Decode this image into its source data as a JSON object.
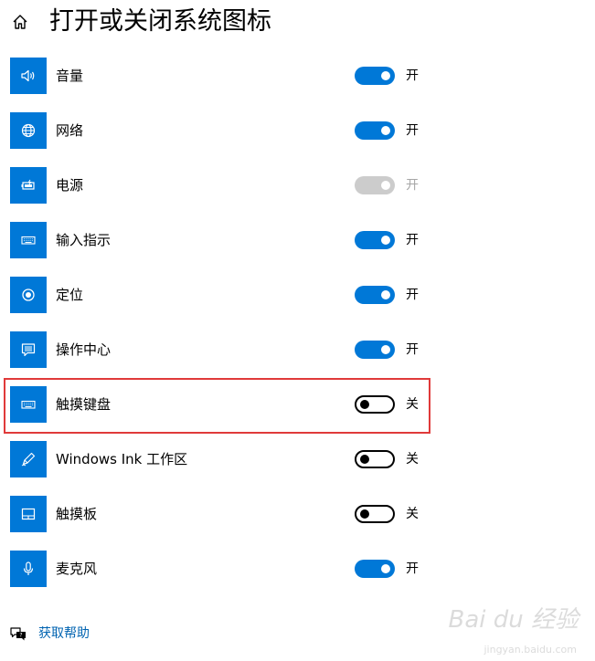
{
  "header": {
    "title": "打开或关闭系统图标",
    "home_icon": "home-icon"
  },
  "items": [
    {
      "name": "volume",
      "icon": "speaker-icon",
      "label": "音量",
      "state": "开",
      "toggle": "on"
    },
    {
      "name": "network",
      "icon": "globe-icon",
      "label": "网络",
      "state": "开",
      "toggle": "on"
    },
    {
      "name": "power",
      "icon": "battery-icon",
      "label": "电源",
      "state": "开",
      "toggle": "disabled"
    },
    {
      "name": "input-indicator",
      "icon": "keyboard-icon",
      "label": "输入指示",
      "state": "开",
      "toggle": "on"
    },
    {
      "name": "location",
      "icon": "location-icon",
      "label": "定位",
      "state": "开",
      "toggle": "on"
    },
    {
      "name": "action-center",
      "icon": "action-center-icon",
      "label": "操作中心",
      "state": "开",
      "toggle": "on"
    },
    {
      "name": "touch-keyboard",
      "icon": "keyboard-icon",
      "label": "触摸键盘",
      "state": "关",
      "toggle": "off"
    },
    {
      "name": "windows-ink",
      "icon": "pen-icon",
      "label": "Windows Ink 工作区",
      "state": "关",
      "toggle": "off"
    },
    {
      "name": "touchpad",
      "icon": "touchpad-icon",
      "label": "触摸板",
      "state": "关",
      "toggle": "off"
    },
    {
      "name": "microphone",
      "icon": "microphone-icon",
      "label": "麦克风",
      "state": "开",
      "toggle": "on"
    }
  ],
  "help": {
    "label": "获取帮助",
    "icon": "help-chat-icon"
  },
  "watermark": {
    "main": "Bai du 经验",
    "sub": "jingyan.baidu.com"
  },
  "colors": {
    "accent": "#0078d7",
    "highlight": "#e03a3a",
    "link": "#0063b1",
    "disabled": "#cccccc"
  }
}
